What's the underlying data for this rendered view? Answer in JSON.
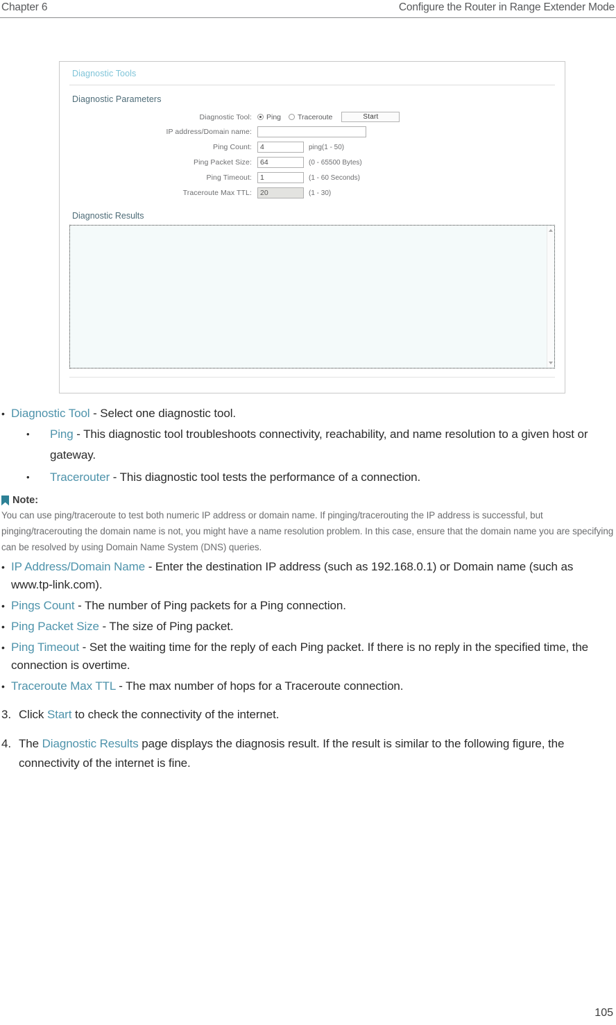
{
  "header": {
    "chapter": "Chapter 6",
    "section": "Configure the Router in Range Extender Mode"
  },
  "screenshot": {
    "panel_title": "Diagnostic Tools",
    "parameters_title": "Diagnostic Parameters",
    "fields": [
      {
        "label": "Diagnostic Tool:",
        "type": "radio",
        "options": [
          "Ping",
          "Traceroute"
        ],
        "selected": "Ping",
        "button": "Start"
      },
      {
        "label": "IP address/Domain name:",
        "type": "text",
        "value": "",
        "width": "wide",
        "hint": ""
      },
      {
        "label": "Ping Count:",
        "type": "text",
        "value": "4",
        "width": "small",
        "hint": "ping(1 - 50)"
      },
      {
        "label": "Ping Packet Size:",
        "type": "text",
        "value": "64",
        "width": "small",
        "hint": "(0 - 65500 Bytes)"
      },
      {
        "label": "Ping Timeout:",
        "type": "text",
        "value": "1",
        "width": "small",
        "hint": "(1 - 60 Seconds)"
      },
      {
        "label": "Traceroute Max TTL:",
        "type": "text",
        "value": "20",
        "width": "small",
        "hint": "(1 - 30)",
        "disabled": true
      }
    ],
    "results_title": "Diagnostic Results",
    "results_text": ""
  },
  "body": {
    "bullet_diagnostic_tool": {
      "term": "Diagnostic Tool",
      "desc": " - Select one diagnostic tool."
    },
    "sub_bullets": [
      {
        "term": "Ping",
        "desc": " - This diagnostic tool troubleshoots connectivity, reachability, and name resolution to a given host or gateway."
      },
      {
        "term": "Tracerouter",
        "desc": " - This diagnostic tool tests the performance of a connection."
      }
    ],
    "note": {
      "label": "Note:",
      "text": "You can use ping/traceroute to test both numeric IP address or domain name. If pinging/tracerouting the IP address is successful, but pinging/tracerouting the domain name is not, you might have a name resolution problem. In this case, ensure that the domain name you are specifying can be resolved by using Domain Name System (DNS) queries."
    },
    "bullets": [
      {
        "term": "IP Address/Domain Name",
        "desc": " - Enter the destination IP address (such as 192.168.0.1) or Domain name (such as www.tp-link.com)."
      },
      {
        "term": "Pings Count",
        "desc": " - The number of Ping packets for a Ping connection."
      },
      {
        "term": "Ping Packet Size",
        "desc": " - The size of Ping packet."
      },
      {
        "term": "Ping Timeout",
        "desc": " - Set the waiting time for the reply of each Ping packet. If there is no reply in the specified time, the connection is overtime."
      },
      {
        "term": "Traceroute Max TTL",
        "desc": " - The max number of hops for a Traceroute connection."
      }
    ],
    "steps": [
      {
        "number": "3.",
        "pre": "Click ",
        "term": "Start",
        "post": " to check the connectivity of the internet."
      },
      {
        "number": "4.",
        "pre": "The ",
        "term": "Diagnostic Results",
        "post": " page displays the diagnosis result. If the result is similar to the following figure, the connectivity of the internet is fine."
      }
    ]
  },
  "footer": {
    "page_number": "105"
  },
  "colors": {
    "link": "#4e93ab",
    "panel_title": "#7fc4d8",
    "section_title": "#4d6b77",
    "note_ribbon": "#2d8196"
  }
}
